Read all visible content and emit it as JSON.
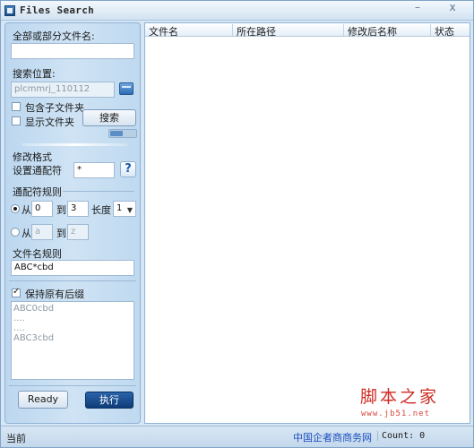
{
  "window": {
    "title": "Files Search",
    "min_glyph": "–",
    "max_glyph": "□",
    "close_glyph": "x"
  },
  "search": {
    "name_label": "全部或部分文件名:",
    "name_value": "",
    "location_label": "搜索位置:",
    "location_value": "plcmmrj_110112",
    "include_subfolders_label": "包含子文件夹",
    "include_subfolders_checked": false,
    "show_folders_label": "显示文件夹",
    "show_folders_checked": false,
    "search_button": "搜索"
  },
  "rename": {
    "format_label": "修改格式",
    "wildcard_label": "设置通配符",
    "wildcard_value": "*",
    "help_glyph": "?",
    "rules_label": "通配符规则",
    "from_label": "从",
    "to_label": "到",
    "from_value": "0",
    "to_value": "3",
    "length_label": "长度",
    "length_value": "1",
    "from_label_2": "从",
    "to_label_2": "到",
    "from_placeholder_2": "a",
    "to_placeholder_2": "z",
    "filename_rule_label": "文件名规则",
    "filename_rule_value": "ABC*cbd",
    "keep_extension_label": "保持原有后缀",
    "keep_extension_checked": true,
    "preview_lines": [
      "ABC0cbd",
      "....",
      "....",
      "ABC3cbd"
    ]
  },
  "actions": {
    "ready_button": "Ready",
    "execute_button": "执行"
  },
  "results": {
    "columns": [
      "文件名",
      "所在路径",
      "修改后名称",
      "状态"
    ],
    "rows": []
  },
  "status": {
    "text": "当前",
    "link": "中国企者商商务网",
    "count": "Count: 0"
  },
  "watermark": {
    "logo": "脚本之家",
    "url": "www.jb51.net"
  }
}
